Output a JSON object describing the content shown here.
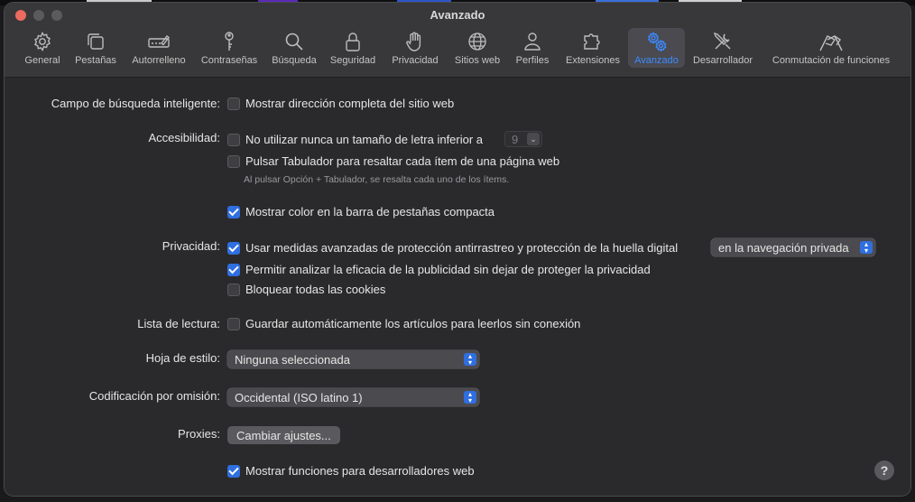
{
  "window": {
    "title": "Avanzado"
  },
  "colors": {
    "accent": "#2f6fe0",
    "close": "#ec6a5e",
    "inactive_light": "#5b5b5d"
  },
  "toolbar": [
    {
      "label": "General",
      "icon": "gear-icon"
    },
    {
      "label": "Pestañas",
      "icon": "tabs-icon"
    },
    {
      "label": "Autorrelleno",
      "icon": "autofill-icon"
    },
    {
      "label": "Contraseñas",
      "icon": "key-icon"
    },
    {
      "label": "Búsqueda",
      "icon": "search-icon"
    },
    {
      "label": "Seguridad",
      "icon": "lock-icon"
    },
    {
      "label": "Privacidad",
      "icon": "hand-icon"
    },
    {
      "label": "Sitios web",
      "icon": "globe-icon"
    },
    {
      "label": "Perfiles",
      "icon": "person-icon"
    },
    {
      "label": "Extensiones",
      "icon": "puzzle-icon"
    },
    {
      "label": "Avanzado",
      "icon": "gears-icon",
      "active": true
    },
    {
      "label": "Desarrollador",
      "icon": "tools-icon"
    },
    {
      "label": "Conmutación de funciones",
      "icon": "flags-icon"
    }
  ],
  "labels": {
    "smart_search": "Campo de búsqueda inteligente:",
    "accessibility": "Accesibilidad:",
    "privacy": "Privacidad:",
    "reading_list": "Lista de lectura:",
    "stylesheet": "Hoja de estilo:",
    "encoding": "Codificación por omisión:",
    "proxies": "Proxies:"
  },
  "options": {
    "show_full_address": {
      "label": "Mostrar dirección completa del sitio web",
      "checked": false
    },
    "min_font_size": {
      "label": "No utilizar nunca un tamaño de letra inferior a",
      "checked": false,
      "value": "9"
    },
    "tab_highlight": {
      "label": "Pulsar Tabulador para resaltar cada ítem de una página web",
      "checked": false,
      "hint": "Al pulsar Opción + Tabulador, se resalta cada uno de los ítems."
    },
    "compact_tab_color": {
      "label": "Mostrar color en la barra de pestañas compacta",
      "checked": true
    },
    "advanced_tracking": {
      "label": "Usar medidas avanzadas de protección antirrastreo y protección de la huella digital",
      "checked": true,
      "select_value": "en la navegación privada"
    },
    "ad_measurement": {
      "label": "Permitir analizar la eficacia de la publicidad sin dejar de proteger la privacidad",
      "checked": true
    },
    "block_cookies": {
      "label": "Bloquear todas las cookies",
      "checked": false
    },
    "save_offline": {
      "label": "Guardar automáticamente los artículos para leerlos sin conexión",
      "checked": false
    },
    "stylesheet_value": "Ninguna seleccionada",
    "encoding_value": "Occidental (ISO latino 1)",
    "proxies_button": "Cambiar ajustes...",
    "show_dev_features": {
      "label": "Mostrar funciones para desarrolladores web",
      "checked": true
    }
  },
  "help": "?"
}
